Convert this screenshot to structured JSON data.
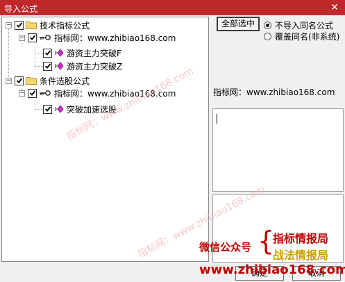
{
  "window": {
    "title": "导入公式",
    "close_glyph": "✕"
  },
  "tree": {
    "groups": [
      {
        "label": "技术指标公式",
        "checked": true,
        "source": {
          "label": "指标网：www.zhibiao168.com",
          "checked": true,
          "items": [
            {
              "label": "游资主力突破F",
              "checked": true
            },
            {
              "label": "游资主力突破Z",
              "checked": true
            }
          ]
        }
      },
      {
        "label": "条件选股公式",
        "checked": true,
        "source": {
          "label": "指标网：www.zhibiao168.com",
          "checked": true,
          "items": [
            {
              "label": "突破加速选股",
              "checked": true
            }
          ]
        }
      }
    ]
  },
  "controls": {
    "select_all_label": "全部选中",
    "options": [
      {
        "label": "不导入同名公式",
        "selected": true
      },
      {
        "label": "覆盖同名(非系统)",
        "selected": false
      }
    ]
  },
  "details": {
    "source_text": "指标网：www.zhibiao168.com"
  },
  "promo": {
    "prefix": "微信公众号",
    "brace": "{",
    "line1": "指标情报局",
    "line2": "战法情报局",
    "url": "www.zhibiao168.com"
  },
  "watermark": {
    "text": "指标网：www.zhibiao168.com"
  },
  "buttons": {
    "ok_label": "确定",
    "cancel_label": "取消"
  },
  "colors": {
    "title_bar": "#c0282b",
    "promo_red": "#c00000",
    "promo_gold": "#c9a000",
    "watermark": "#f2b8b8"
  }
}
